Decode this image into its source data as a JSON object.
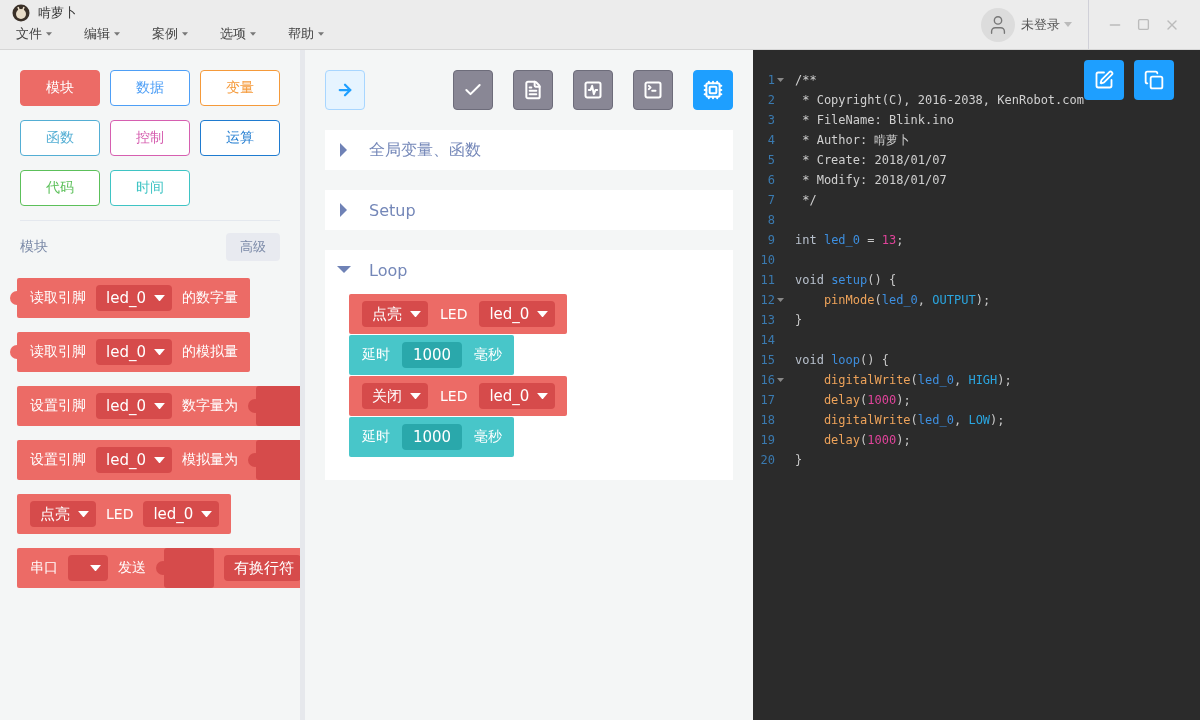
{
  "app": {
    "title": "啃萝卜"
  },
  "menu": [
    {
      "label": "文件"
    },
    {
      "label": "编辑"
    },
    {
      "label": "案例"
    },
    {
      "label": "选项"
    },
    {
      "label": "帮助"
    }
  ],
  "user": {
    "label": "未登录"
  },
  "categories": [
    {
      "label": "模块",
      "color": "#ec6b66",
      "selected": true
    },
    {
      "label": "数据",
      "color": "#4e9ff6",
      "selected": false
    },
    {
      "label": "变量",
      "color": "#f59a3a",
      "selected": false
    },
    {
      "label": "函数",
      "color": "#53aed4",
      "selected": false
    },
    {
      "label": "控制",
      "color": "#d65fb0",
      "selected": false
    },
    {
      "label": "运算",
      "color": "#1f7bd0",
      "selected": false
    },
    {
      "label": "代码",
      "color": "#5cc05a",
      "selected": false
    },
    {
      "label": "时间",
      "color": "#3fc4c4",
      "selected": false
    }
  ],
  "palette": {
    "title": "模块",
    "advanced": "高级",
    "blocks": [
      {
        "plug": true,
        "parts": [
          {
            "kind": "text",
            "text": "读取引脚"
          },
          {
            "kind": "dropdown",
            "text": "led_0"
          },
          {
            "kind": "text",
            "text": "的数字量"
          }
        ]
      },
      {
        "plug": true,
        "parts": [
          {
            "kind": "text",
            "text": "读取引脚"
          },
          {
            "kind": "dropdown",
            "text": "led_0"
          },
          {
            "kind": "text",
            "text": "的模拟量"
          }
        ]
      },
      {
        "plug": false,
        "parts": [
          {
            "kind": "text",
            "text": "设置引脚"
          },
          {
            "kind": "dropdown",
            "text": "led_0"
          },
          {
            "kind": "text",
            "text": "数字量为"
          },
          {
            "kind": "slot"
          }
        ]
      },
      {
        "plug": false,
        "parts": [
          {
            "kind": "text",
            "text": "设置引脚"
          },
          {
            "kind": "dropdown",
            "text": "led_0"
          },
          {
            "kind": "text",
            "text": "模拟量为"
          },
          {
            "kind": "slot"
          }
        ]
      },
      {
        "plug": false,
        "parts": [
          {
            "kind": "dropdown",
            "text": "点亮"
          },
          {
            "kind": "text",
            "text": "LED"
          },
          {
            "kind": "dropdown",
            "text": "led_0"
          }
        ]
      },
      {
        "plug": false,
        "parts": [
          {
            "kind": "text",
            "text": "串口"
          },
          {
            "kind": "dropdown"
          },
          {
            "kind": "text",
            "text": "发送"
          },
          {
            "kind": "slot"
          },
          {
            "kind": "label",
            "text": "有换行符"
          }
        ]
      }
    ]
  },
  "toolbar": [
    {
      "selected": false
    },
    {
      "selected": false
    },
    {
      "selected": false
    },
    {
      "selected": false
    },
    {
      "selected": true
    }
  ],
  "sections": [
    {
      "title": "全局变量、函数",
      "expanded": false
    },
    {
      "title": "Setup",
      "expanded": false
    },
    {
      "title": "Loop",
      "expanded": true,
      "blocks": [
        {
          "color": "#ec6b66",
          "parts": [
            {
              "kind": "dropdown",
              "text": "点亮"
            },
            {
              "kind": "text",
              "text": "LED"
            },
            {
              "kind": "dropdown",
              "text": "led_0"
            }
          ]
        },
        {
          "color": "#48c6c9",
          "parts": [
            {
              "kind": "text",
              "text": "延时"
            },
            {
              "kind": "input",
              "text": "1000"
            },
            {
              "kind": "text",
              "text": "毫秒"
            }
          ]
        },
        {
          "color": "#ec6b66",
          "parts": [
            {
              "kind": "dropdown",
              "text": "关闭"
            },
            {
              "kind": "text",
              "text": "LED"
            },
            {
              "kind": "dropdown",
              "text": "led_0"
            }
          ]
        },
        {
          "color": "#48c6c9",
          "parts": [
            {
              "kind": "text",
              "text": "延时"
            },
            {
              "kind": "input",
              "text": "1000"
            },
            {
              "kind": "text",
              "text": "毫秒"
            }
          ]
        }
      ]
    }
  ],
  "code": [
    {
      "num": "1",
      "fold": true,
      "tokens": [
        {
          "kind": "comment",
          "text": "/**"
        }
      ]
    },
    {
      "num": "2",
      "fold": false,
      "tokens": [
        {
          "kind": "comment",
          "text": " * Copyright(C), 2016-2038, KenRobot.com"
        }
      ]
    },
    {
      "num": "3",
      "fold": false,
      "tokens": [
        {
          "kind": "comment",
          "text": " * FileName: Blink.ino"
        }
      ]
    },
    {
      "num": "4",
      "fold": false,
      "tokens": [
        {
          "kind": "comment",
          "text": " * Author: 啃萝卜"
        }
      ]
    },
    {
      "num": "5",
      "fold": false,
      "tokens": [
        {
          "kind": "comment",
          "text": " * Create: 2018/01/07"
        }
      ]
    },
    {
      "num": "6",
      "fold": false,
      "tokens": [
        {
          "kind": "comment",
          "text": " * Modify: 2018/01/07"
        }
      ]
    },
    {
      "num": "7",
      "fold": false,
      "tokens": [
        {
          "kind": "comment",
          "text": " */"
        }
      ]
    },
    {
      "num": "8",
      "fold": false
    },
    {
      "num": "9",
      "fold": false,
      "tokens": [
        {
          "kind": "keyword",
          "text": "int "
        },
        {
          "kind": "name",
          "text": "led_0"
        },
        {
          "kind": "plain",
          "text": " = "
        },
        {
          "kind": "number",
          "text": "13"
        },
        {
          "kind": "plain",
          "text": ";"
        }
      ]
    },
    {
      "num": "10",
      "fold": false
    },
    {
      "num": "11",
      "fold": false,
      "tokens": [
        {
          "kind": "keyword",
          "text": "void "
        },
        {
          "kind": "name",
          "text": "setup"
        },
        {
          "kind": "plain",
          "text": "() {"
        }
      ]
    },
    {
      "num": "12",
      "fold": true,
      "tokens": [
        {
          "kind": "call",
          "text": "    pinMode"
        },
        {
          "kind": "plain",
          "text": "("
        },
        {
          "kind": "name",
          "text": "led_0"
        },
        {
          "kind": "plain",
          "text": ", "
        },
        {
          "kind": "constant",
          "text": "OUTPUT"
        },
        {
          "kind": "plain",
          "text": ");"
        }
      ]
    },
    {
      "num": "13",
      "fold": false,
      "tokens": [
        {
          "kind": "plain",
          "text": "}"
        }
      ]
    },
    {
      "num": "14",
      "fold": false
    },
    {
      "num": "15",
      "fold": false,
      "tokens": [
        {
          "kind": "keyword",
          "text": "void "
        },
        {
          "kind": "name",
          "text": "loop"
        },
        {
          "kind": "plain",
          "text": "() {"
        }
      ]
    },
    {
      "num": "16",
      "fold": true,
      "tokens": [
        {
          "kind": "call",
          "text": "    digitalWrite"
        },
        {
          "kind": "plain",
          "text": "("
        },
        {
          "kind": "name",
          "text": "led_0"
        },
        {
          "kind": "plain",
          "text": ", "
        },
        {
          "kind": "constant",
          "text": "HIGH"
        },
        {
          "kind": "plain",
          "text": ");"
        }
      ]
    },
    {
      "num": "17",
      "fold": false,
      "tokens": [
        {
          "kind": "call",
          "text": "    delay"
        },
        {
          "kind": "plain",
          "text": "("
        },
        {
          "kind": "number",
          "text": "1000"
        },
        {
          "kind": "plain",
          "text": ");"
        }
      ]
    },
    {
      "num": "18",
      "fold": false,
      "tokens": [
        {
          "kind": "call",
          "text": "    digitalWrite"
        },
        {
          "kind": "plain",
          "text": "("
        },
        {
          "kind": "name",
          "text": "led_0"
        },
        {
          "kind": "plain",
          "text": ", "
        },
        {
          "kind": "constant",
          "text": "LOW"
        },
        {
          "kind": "plain",
          "text": ");"
        }
      ]
    },
    {
      "num": "19",
      "fold": false,
      "tokens": [
        {
          "kind": "call",
          "text": "    delay"
        },
        {
          "kind": "plain",
          "text": "("
        },
        {
          "kind": "number",
          "text": "1000"
        },
        {
          "kind": "plain",
          "text": ");"
        }
      ]
    },
    {
      "num": "20",
      "fold": false,
      "tokens": [
        {
          "kind": "plain",
          "text": "}"
        }
      ]
    }
  ]
}
